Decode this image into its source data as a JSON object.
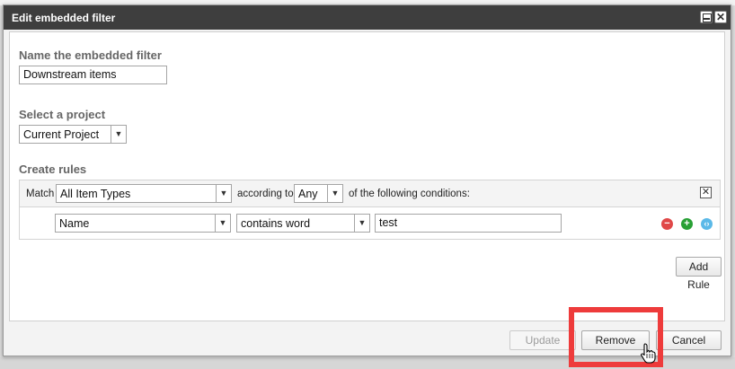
{
  "dialog": {
    "title": "Edit embedded filter",
    "minimize_icon": "window-minimize-icon",
    "close_icon": "close-icon",
    "close_glyph": "✕"
  },
  "name_section": {
    "label": "Name the embedded filter",
    "value": "Downstream items"
  },
  "project_section": {
    "label": "Select a project",
    "selected": "Current Project"
  },
  "rules_section": {
    "label": "Create rules",
    "match_label": "Match",
    "item_types_selected": "All Item Types",
    "according_to_label": "according to",
    "any_selected": "Any",
    "conditions_label": "of the following conditions:",
    "remove_group_glyph": "✕",
    "rule": {
      "field_selected": "Name",
      "operator_selected": "contains word",
      "value": "test",
      "remove_icon": "minus-circle-icon",
      "add_icon": "plus-circle-icon",
      "group_icon": "nest-circle-icon"
    },
    "add_rule_label": "Add Rule"
  },
  "footer": {
    "update_label": "Update",
    "remove_label": "Remove",
    "cancel_label": "Cancel"
  },
  "colors": {
    "titlebar": "#3e3e3e",
    "highlight": "#ee3b3b",
    "remove_icon": "#e04848",
    "add_icon": "#28a035",
    "group_icon": "#5bb9e8"
  }
}
